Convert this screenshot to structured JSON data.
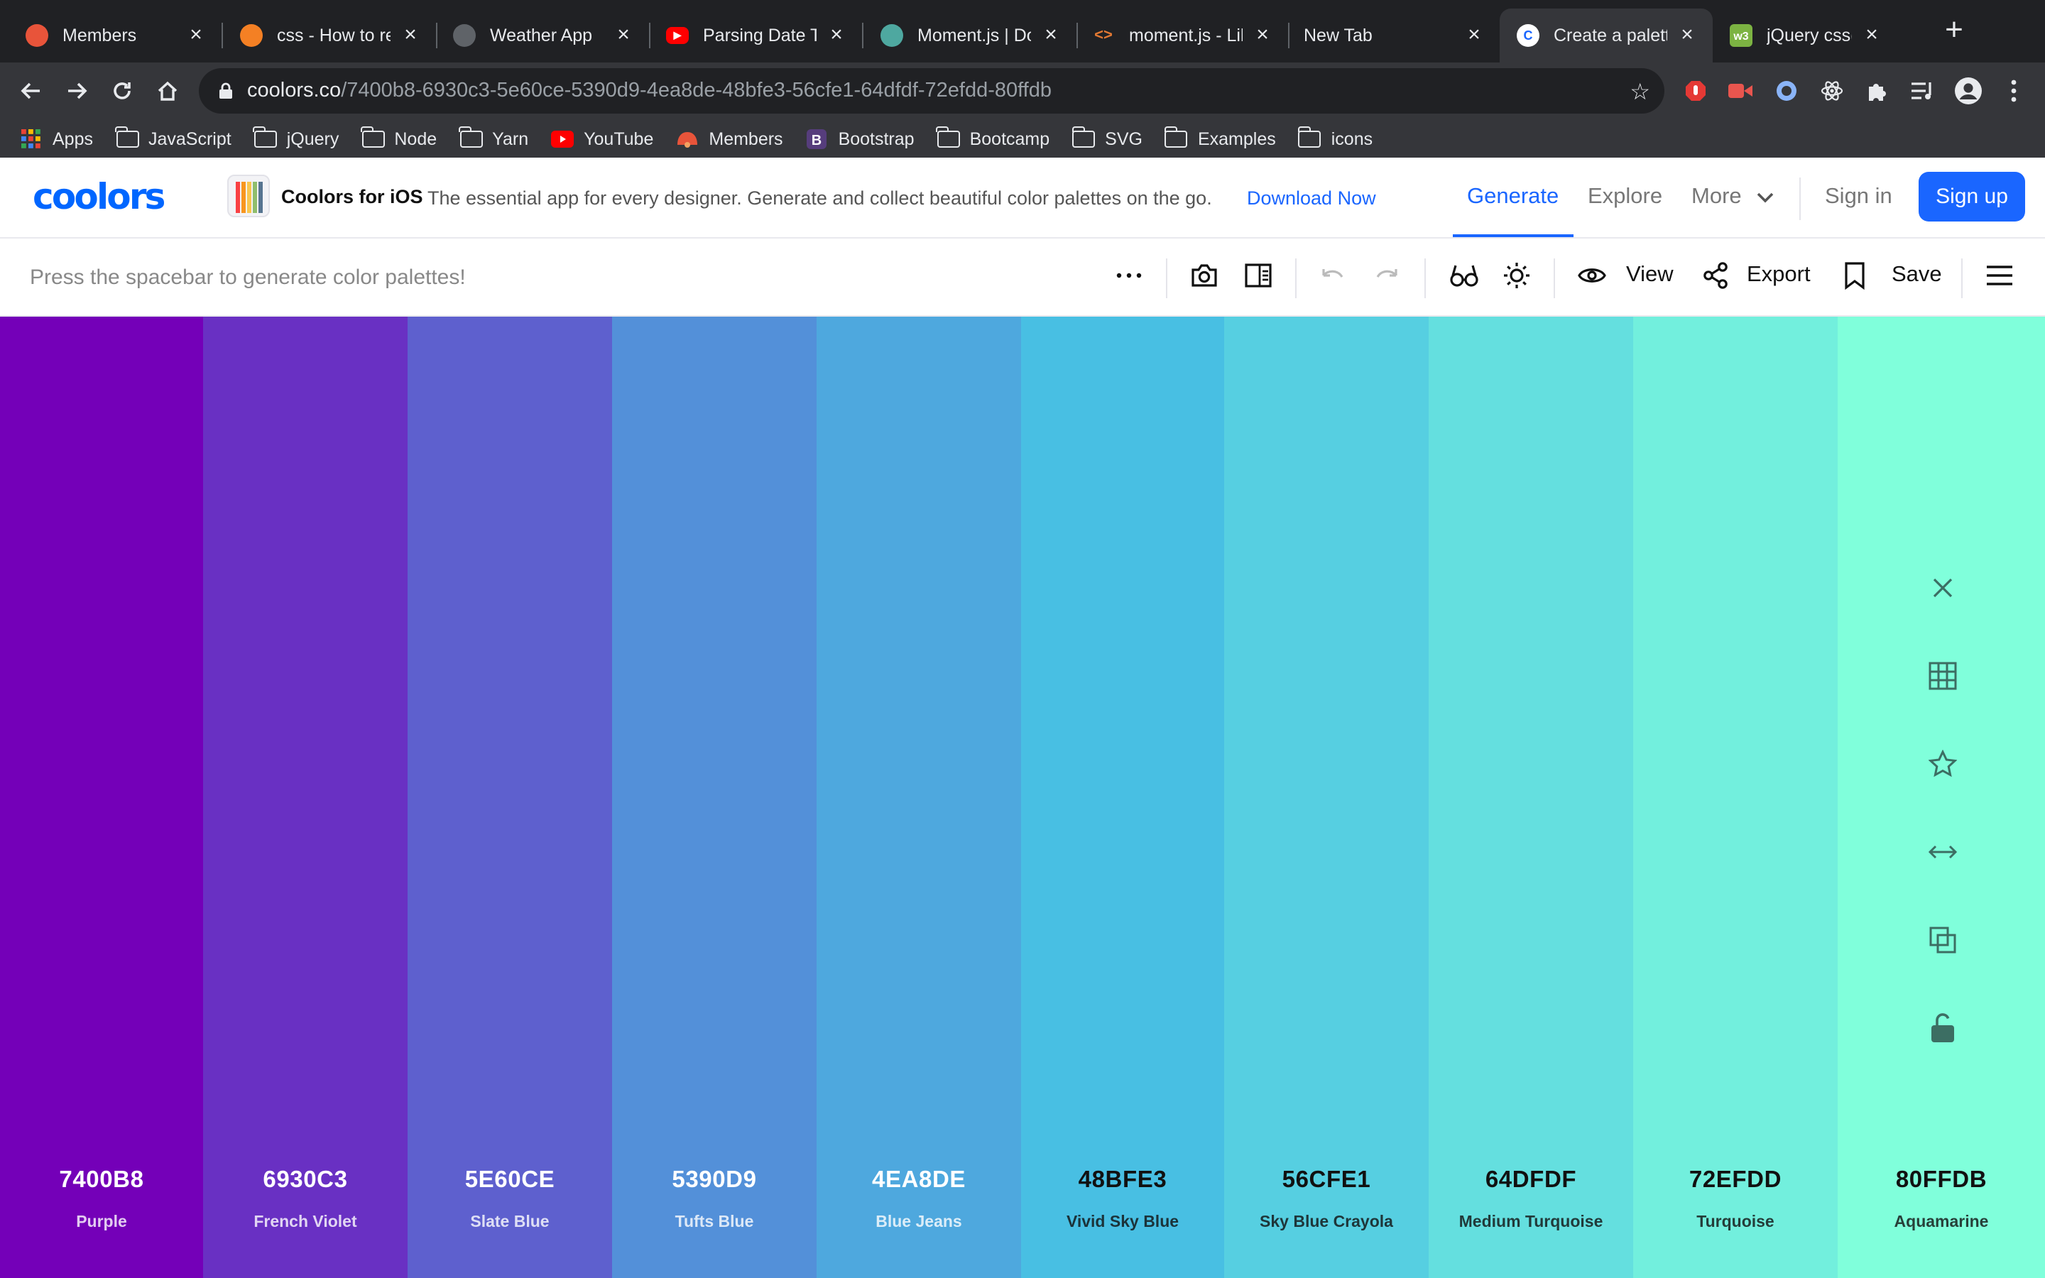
{
  "browser": {
    "tabs": [
      {
        "title": "Members",
        "favicon_color": "#e8543a",
        "favicon_glyph": ""
      },
      {
        "title": "css - How to re",
        "favicon_color": "#f48024",
        "favicon_glyph": ""
      },
      {
        "title": "Weather App",
        "favicon_color": "#5f6368",
        "favicon_glyph": ""
      },
      {
        "title": "Parsing Date Ti",
        "favicon_color": "#ff0000",
        "favicon_glyph": "▶"
      },
      {
        "title": "Moment.js | Do",
        "favicon_color": "#4ea8a0",
        "favicon_glyph": ""
      },
      {
        "title": "moment.js - Lil",
        "favicon_color": "#e37933",
        "favicon_glyph": "<>"
      },
      {
        "title": "New Tab",
        "favicon_color": "",
        "favicon_glyph": ""
      },
      {
        "title": "Create a palett",
        "favicon_color": "#ffffff",
        "favicon_glyph": "C"
      },
      {
        "title": "jQuery css() M",
        "favicon_color": "#7cb342",
        "favicon_glyph": "w3"
      }
    ],
    "active_tab_index": 7,
    "url_host": "coolors.co",
    "url_path": "/7400b8-6930c3-5e60ce-5390d9-4ea8de-48bfe3-56cfe1-64dfdf-72efdd-80ffdb",
    "bookmarks": [
      {
        "label": "Apps",
        "icon": "apps-grid-icon"
      },
      {
        "label": "JavaScript",
        "icon": "folder-icon"
      },
      {
        "label": "jQuery",
        "icon": "folder-icon"
      },
      {
        "label": "Node",
        "icon": "folder-icon"
      },
      {
        "label": "Yarn",
        "icon": "folder-icon"
      },
      {
        "label": "YouTube",
        "icon": "youtube-icon"
      },
      {
        "label": "Members",
        "icon": "members-icon"
      },
      {
        "label": "Bootstrap",
        "icon": "bootstrap-icon"
      },
      {
        "label": "Bootcamp",
        "icon": "folder-icon"
      },
      {
        "label": "SVG",
        "icon": "folder-icon"
      },
      {
        "label": "Examples",
        "icon": "folder-icon"
      },
      {
        "label": "icons",
        "icon": "folder-icon"
      }
    ]
  },
  "header": {
    "logo": "coolors",
    "ios_title": "Coolors for iOS",
    "ios_desc": "The essential app for every designer. Generate and collect beautiful color palettes on the go.",
    "ios_link": "Download Now",
    "nav": {
      "generate": "Generate",
      "explore": "Explore",
      "more": "More"
    },
    "sign_in": "Sign in",
    "sign_up": "Sign up",
    "accent": "#1a66ff"
  },
  "toolbar": {
    "hint": "Press the spacebar to generate color palettes!",
    "view_label": "View",
    "export_label": "Export",
    "save_label": "Save"
  },
  "palette": [
    {
      "hex": "7400B8",
      "name": "Purple",
      "color": "#7400B8",
      "text": "#ffffff"
    },
    {
      "hex": "6930C3",
      "name": "French Violet",
      "color": "#6930C3",
      "text": "#ffffff"
    },
    {
      "hex": "5E60CE",
      "name": "Slate Blue",
      "color": "#5E60CE",
      "text": "#ffffff"
    },
    {
      "hex": "5390D9",
      "name": "Tufts Blue",
      "color": "#5390D9",
      "text": "#ffffff"
    },
    {
      "hex": "4EA8DE",
      "name": "Blue Jeans",
      "color": "#4EA8DE",
      "text": "#ffffff"
    },
    {
      "hex": "48BFE3",
      "name": "Vivid Sky Blue",
      "color": "#48BFE3",
      "text": "#111111"
    },
    {
      "hex": "56CFE1",
      "name": "Sky Blue Crayola",
      "color": "#56CFE1",
      "text": "#111111"
    },
    {
      "hex": "64DFDF",
      "name": "Medium Turquoise",
      "color": "#64DFDF",
      "text": "#111111"
    },
    {
      "hex": "72EFDD",
      "name": "Turquoise",
      "color": "#72EFDD",
      "text": "#111111"
    },
    {
      "hex": "80FFDB",
      "name": "Aquamarine",
      "color": "#80FFDB",
      "text": "#111111"
    }
  ],
  "swatch_tools": [
    "close-icon",
    "grid-icon",
    "star-icon",
    "drag-arrows-icon",
    "copy-icon",
    "lock-icon"
  ]
}
